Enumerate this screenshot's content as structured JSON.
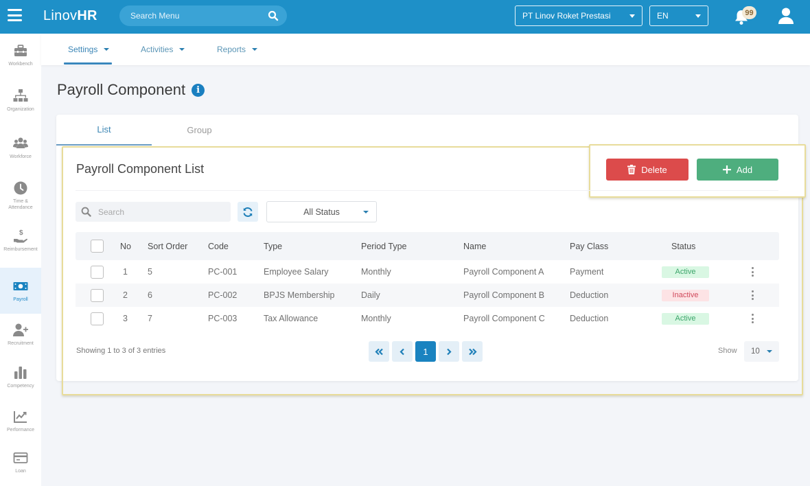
{
  "app": {
    "logo_light": "Linov",
    "logo_bold": "HR"
  },
  "topbar": {
    "search_placeholder": "Search Menu",
    "company": "PT Linov Roket Prestasi",
    "language": "EN",
    "notification_count": "99"
  },
  "sidebar": {
    "items": [
      {
        "label": "Workbench",
        "icon": "toolbox-icon"
      },
      {
        "label": "Organization",
        "icon": "org-chart-icon"
      },
      {
        "label": "Workforce",
        "icon": "users-icon"
      },
      {
        "label": "Time & Attendance",
        "icon": "clock-icon"
      },
      {
        "label": "Reimbursement",
        "icon": "hand-dollar-icon"
      },
      {
        "label": "Payroll",
        "icon": "money-bill-icon",
        "active": true
      },
      {
        "label": "Recruitment",
        "icon": "user-plus-icon"
      },
      {
        "label": "Competency",
        "icon": "bar-chart-icon"
      },
      {
        "label": "Performance",
        "icon": "line-chart-icon"
      },
      {
        "label": "Loan",
        "icon": "credit-card-icon"
      }
    ]
  },
  "subnav": {
    "items": [
      {
        "label": "Settings",
        "active": true
      },
      {
        "label": "Activities"
      },
      {
        "label": "Reports"
      }
    ]
  },
  "page": {
    "title": "Payroll Component"
  },
  "tabs": [
    {
      "label": "List",
      "active": true
    },
    {
      "label": "Group"
    }
  ],
  "list": {
    "title": "Payroll Component List",
    "delete_label": "Delete",
    "add_label": "Add",
    "search_placeholder": "Search",
    "status_filter": "All Status"
  },
  "table": {
    "columns": [
      "No",
      "Sort Order",
      "Code",
      "Type",
      "Period Type",
      "Name",
      "Pay Class",
      "Status"
    ],
    "rows": [
      {
        "no": "1",
        "sort_order": "5",
        "code": "PC-001",
        "type": "Employee Salary",
        "period_type": "Monthly",
        "name": "Payroll Component A",
        "pay_class": "Payment",
        "status": "Active"
      },
      {
        "no": "2",
        "sort_order": "6",
        "code": "PC-002",
        "type": "BPJS Membership",
        "period_type": "Daily",
        "name": "Payroll Component B",
        "pay_class": "Deduction",
        "status": "Inactive"
      },
      {
        "no": "3",
        "sort_order": "7",
        "code": "PC-003",
        "type": "Tax Allowance",
        "period_type": "Monthly",
        "name": "Payroll Component C",
        "pay_class": "Deduction",
        "status": "Active"
      }
    ]
  },
  "footer": {
    "showing": "Showing 1 to 3 of 3 entries",
    "current_page": "1",
    "show_label": "Show",
    "page_size": "10"
  },
  "colors": {
    "brand": "#1e90c8",
    "delete": "#dc4b4b",
    "add": "#4eae7e",
    "active_bg": "#d9f7e3",
    "active_fg": "#3ca56a",
    "inactive_bg": "#fde3e5",
    "inactive_fg": "#d0485a"
  }
}
